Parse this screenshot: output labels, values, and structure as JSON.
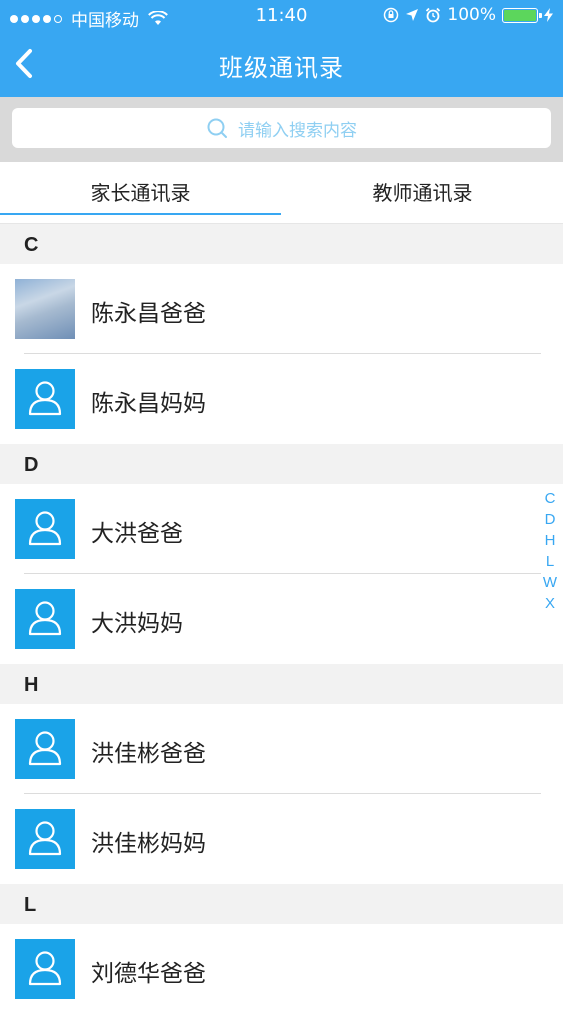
{
  "status": {
    "carrier": "中国移动",
    "time": "11:40",
    "battery": "100%"
  },
  "nav": {
    "title": "班级通讯录"
  },
  "search": {
    "placeholder": "请输入搜索内容"
  },
  "tabs": [
    {
      "label": "家长通讯录",
      "active": true
    },
    {
      "label": "教师通讯录",
      "active": false
    }
  ],
  "sections": [
    {
      "letter": "C",
      "contacts": [
        {
          "name": "陈永昌爸爸",
          "avatar": "photo"
        },
        {
          "name": "陈永昌妈妈",
          "avatar": "default-person-icon"
        }
      ]
    },
    {
      "letter": "D",
      "contacts": [
        {
          "name": "大洪爸爸",
          "avatar": "default-person-icon"
        },
        {
          "name": "大洪妈妈",
          "avatar": "default-person-icon"
        }
      ]
    },
    {
      "letter": "H",
      "contacts": [
        {
          "name": "洪佳彬爸爸",
          "avatar": "default-person-icon"
        },
        {
          "name": "洪佳彬妈妈",
          "avatar": "default-person-icon"
        }
      ]
    },
    {
      "letter": "L",
      "contacts": [
        {
          "name": "刘德华爸爸",
          "avatar": "default-person-icon"
        }
      ]
    }
  ],
  "index_letters": [
    "C",
    "D",
    "H",
    "L",
    "W",
    "X"
  ],
  "colors": {
    "accent": "#38a7f2",
    "avatar_bg": "#1aa3e8",
    "section_bg": "#f2f2f2"
  }
}
